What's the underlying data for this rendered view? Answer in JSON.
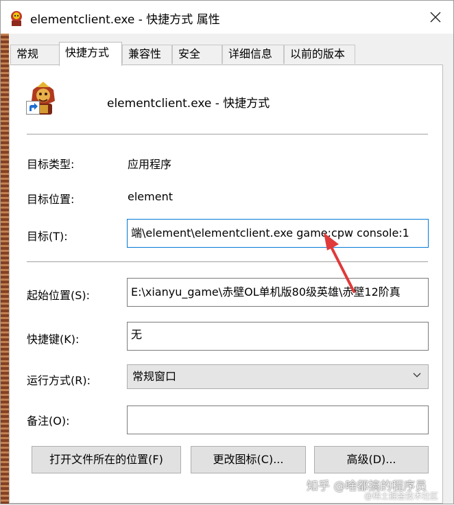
{
  "window": {
    "title": "elementclient.exe - 快捷方式 属性"
  },
  "tabs": [
    {
      "label": "常规",
      "active": false
    },
    {
      "label": "快捷方式",
      "active": true
    },
    {
      "label": "兼容性",
      "active": false
    },
    {
      "label": "安全",
      "active": false
    },
    {
      "label": "详细信息",
      "active": false
    },
    {
      "label": "以前的版本",
      "active": false
    }
  ],
  "header": {
    "shortcut_name": "elementclient.exe - 快捷方式",
    "icon": "game-character-icon",
    "overlay_icon": "shortcut-arrow-icon"
  },
  "properties": {
    "target_type_label": "目标类型:",
    "target_type_value": "应用程序",
    "target_location_label": "目标位置:",
    "target_location_value": "element",
    "target_label": "目标(T):",
    "target_value": "端\\element\\elementclient.exe game:cpw console:1",
    "start_in_label": "起始位置(S):",
    "start_in_value": "E:\\xianyu_game\\赤壁OL单机版80级英雄\\赤壁12阶真",
    "hotkey_label": "快捷键(K):",
    "hotkey_value": "无",
    "run_label": "运行方式(R):",
    "run_value": "常规窗口",
    "comment_label": "备注(O):",
    "comment_value": ""
  },
  "buttons": {
    "open_location": "打开文件所在的位置(F)",
    "change_icon": "更改图标(C)...",
    "advanced": "高级(D)..."
  },
  "watermark": {
    "line1": "知乎 @啥都搞的程序员",
    "line2": "@稀土掘金技术社区"
  },
  "colors": {
    "annotation_arrow": "#e03a3a",
    "focus_border": "#0078d7"
  }
}
